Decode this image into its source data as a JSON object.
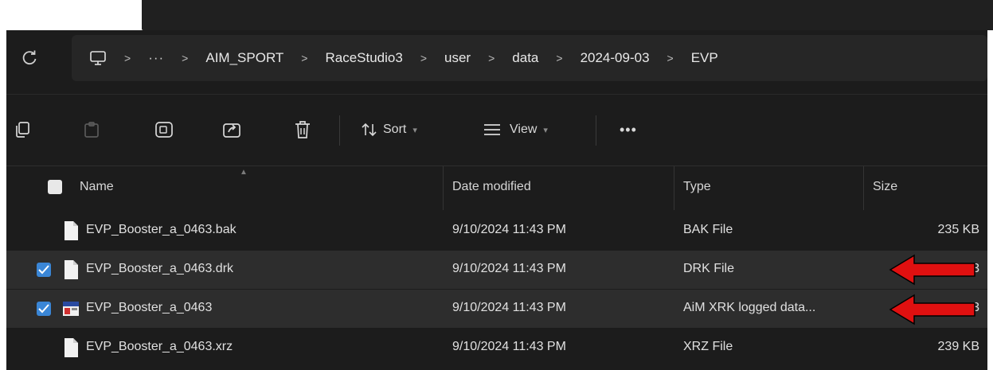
{
  "address": {
    "overflow": "···",
    "crumbs": [
      "AIM_SPORT",
      "RaceStudio3",
      "user",
      "data",
      "2024-09-03",
      "EVP"
    ]
  },
  "toolbar": {
    "sort_label": "Sort",
    "view_label": "View",
    "more_label": "•••"
  },
  "columns": {
    "name": "Name",
    "date": "Date modified",
    "type": "Type",
    "size": "Size"
  },
  "files": [
    {
      "name": "EVP_Booster_a_0463.bak",
      "date": "9/10/2024 11:43 PM",
      "type": "BAK File",
      "size": "235 KB",
      "selected": false,
      "icon": "file-icon"
    },
    {
      "name": "EVP_Booster_a_0463.drk",
      "date": "9/10/2024 11:43 PM",
      "type": "DRK File",
      "size": "3",
      "selected": true,
      "icon": "file-icon"
    },
    {
      "name": "EVP_Booster_a_0463",
      "date": "9/10/2024 11:43 PM",
      "type": "AiM XRK logged data...",
      "size": "3",
      "selected": true,
      "icon": "xrk-file-icon"
    },
    {
      "name": "EVP_Booster_a_0463.xrz",
      "date": "9/10/2024 11:43 PM",
      "type": "XRZ File",
      "size": "239 KB",
      "selected": false,
      "icon": "file-icon"
    }
  ],
  "colors": {
    "background": "#1c1c1c",
    "selected_row": "#2d2d2d",
    "checkbox": "#3a86d6",
    "annotation_arrow": "#e01010"
  }
}
